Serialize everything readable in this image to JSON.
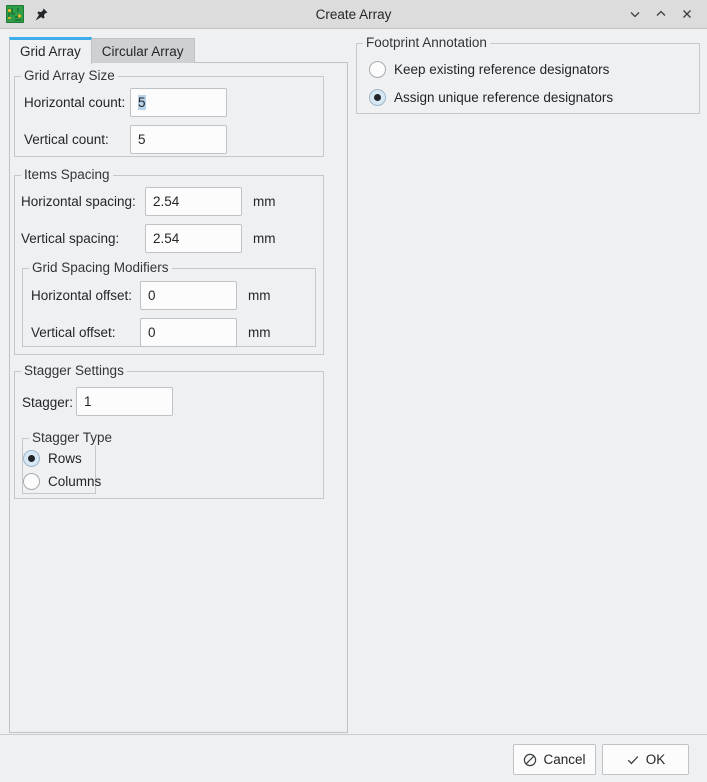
{
  "window": {
    "title": "Create Array",
    "app_icon": "kicad-pcb-icon",
    "pin_icon": "pushpin-icon",
    "controls": [
      {
        "name": "minimize-button",
        "glyph": "⌄"
      },
      {
        "name": "maximize-button",
        "glyph": "⌃"
      },
      {
        "name": "close-button",
        "glyph": "✕"
      }
    ]
  },
  "tabs": [
    {
      "label": "Grid Array",
      "active": true
    },
    {
      "label": "Circular Array",
      "active": false
    }
  ],
  "grid_array_size": {
    "legend": "Grid Array Size",
    "horizontal_count": {
      "label": "Horizontal count:",
      "value": "5",
      "selected": true
    },
    "vertical_count": {
      "label": "Vertical count:",
      "value": "5",
      "selected": false
    }
  },
  "items_spacing": {
    "legend": "Items Spacing",
    "horizontal_spacing": {
      "label": "Horizontal spacing:",
      "value": "2.54",
      "unit": "mm"
    },
    "vertical_spacing": {
      "label": "Vertical spacing:",
      "value": "2.54",
      "unit": "mm"
    },
    "grid_spacing_modifiers": {
      "legend": "Grid Spacing Modifiers",
      "horizontal_offset": {
        "label": "Horizontal offset:",
        "value": "0",
        "unit": "mm"
      },
      "vertical_offset": {
        "label": "Vertical offset:",
        "value": "0",
        "unit": "mm"
      }
    }
  },
  "stagger_settings": {
    "legend": "Stagger Settings",
    "stagger": {
      "label": "Stagger:",
      "value": "1"
    },
    "stagger_type": {
      "legend": "Stagger Type",
      "options": [
        {
          "label": "Rows",
          "checked": true
        },
        {
          "label": "Columns",
          "checked": false
        }
      ]
    }
  },
  "footprint_annotation": {
    "legend": "Footprint Annotation",
    "options": [
      {
        "label": "Keep existing reference designators",
        "checked": false
      },
      {
        "label": "Assign unique reference designators",
        "checked": true
      }
    ]
  },
  "buttons": {
    "cancel": {
      "label": "Cancel",
      "icon": "no-entry-icon"
    },
    "ok": {
      "label": "OK",
      "icon": "checkmark-icon"
    }
  },
  "colors": {
    "accent": "#3daee9",
    "window_bg": "#eff0f1",
    "titlebar_bg": "#dcdcdc",
    "field_bg": "#fcfcfc",
    "selection": "#b7d3ea"
  }
}
